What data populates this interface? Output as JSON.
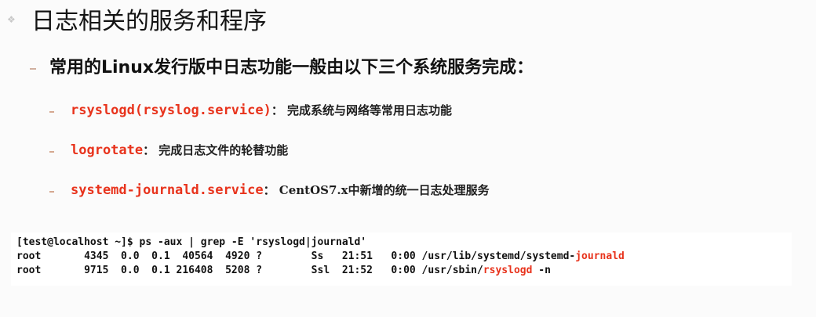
{
  "title": "日志相关的服务和程序",
  "subheading": "常用的Linux发行版中日志功能一般由以下三个系统服务完成：",
  "items": [
    {
      "name": "rsyslogd(rsyslog.service)",
      "sep": "：",
      "desc": "完成系统与网络等常用日志功能"
    },
    {
      "name": "logrotate",
      "sep": "：",
      "desc": "完成日志文件的轮替功能"
    },
    {
      "name": "systemd-journald.service",
      "sep": "：",
      "desc": "CentOS7.x中新增的统一日志处理服务"
    }
  ],
  "terminal": {
    "command": "[test@localhost ~]$ ps -aux | grep -E 'rsyslogd|journald'",
    "rows": [
      {
        "prefix": "root       4345  0.0  0.1  40564  4920 ?        Ss   21:51   0:00 /usr/lib/systemd/systemd-",
        "highlight": "journald",
        "suffix": ""
      },
      {
        "prefix": "root       9715  0.0  0.1 216408  5208 ?        Ssl  21:52   0:00 /usr/sbin/",
        "highlight": "rsyslogd",
        "suffix": " -n"
      }
    ]
  },
  "colors": {
    "accent": "#e8331c",
    "background": "#fbfbfb"
  }
}
